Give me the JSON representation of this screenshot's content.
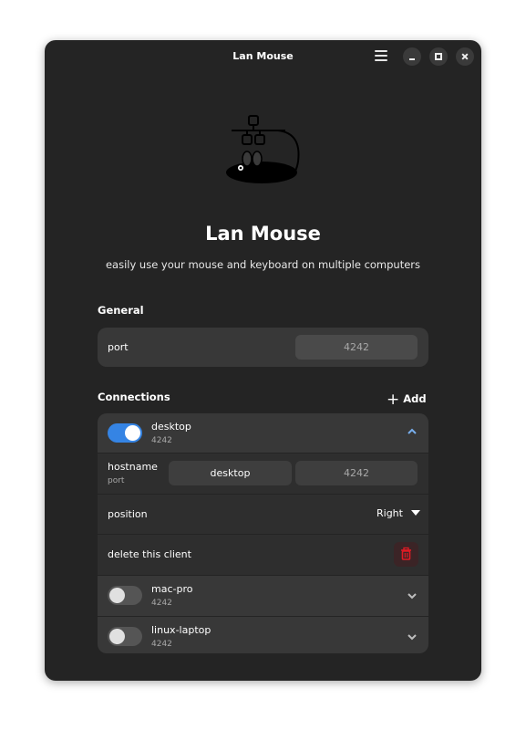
{
  "window": {
    "title": "Lan Mouse",
    "controls": [
      "menu",
      "minimize",
      "maximize",
      "close"
    ]
  },
  "header": {
    "app_name": "Lan Mouse",
    "subtitle": "easily use your mouse and keyboard on multiple computers",
    "logo_icon": "mouse-network-icon"
  },
  "general": {
    "title": "General",
    "port_label": "port",
    "port_value": "4242"
  },
  "connections": {
    "title": "Connections",
    "add_label": "Add",
    "clients": [
      {
        "name": "desktop",
        "port": "4242",
        "enabled": true,
        "expanded": true
      },
      {
        "name": "mac-pro",
        "port": "4242",
        "enabled": false,
        "expanded": false
      },
      {
        "name": "linux-laptop",
        "port": "4242",
        "enabled": false,
        "expanded": false
      }
    ],
    "details": {
      "hostname_label": "hostname",
      "port_label": "port",
      "hostname_value": "desktop",
      "port_value": "4242",
      "position_label": "position",
      "position_value": "Right",
      "delete_label": "delete this client"
    }
  },
  "colors": {
    "accent": "#3584e4",
    "destructive": "#e01b24",
    "window_bg": "#242424",
    "card_bg": "#383838"
  }
}
